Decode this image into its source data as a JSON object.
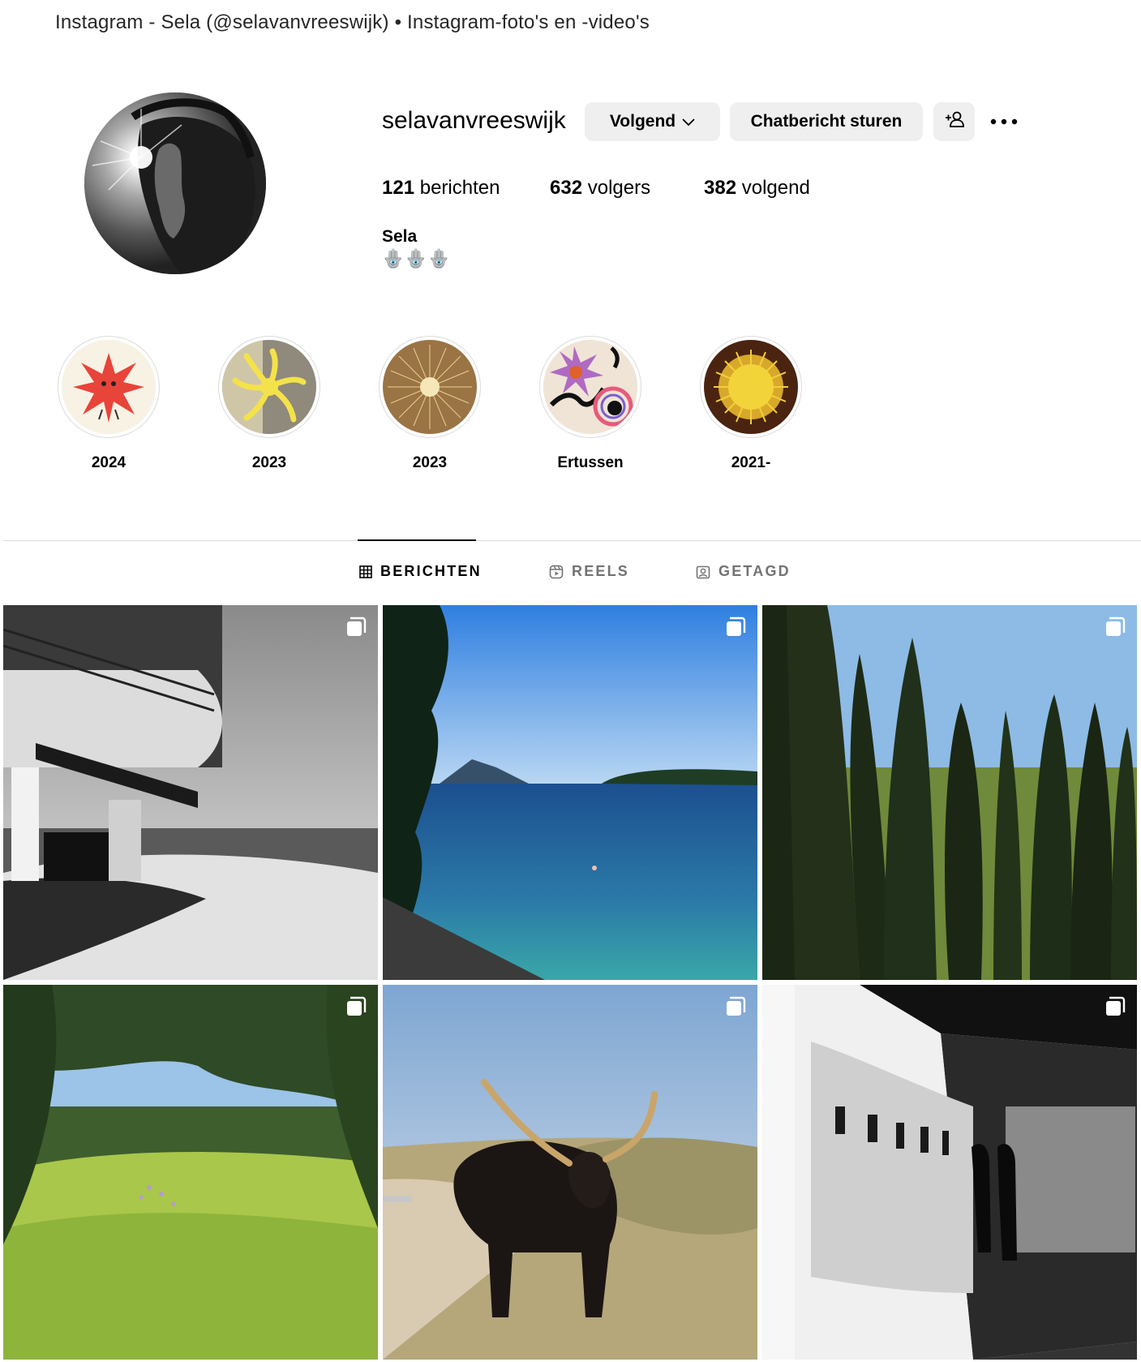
{
  "window": {
    "title": "Instagram - Sela (@selavanvreeswijk) • Instagram-foto's en -video's"
  },
  "profile": {
    "username": "selavanvreeswijk",
    "name": "Sela",
    "bio": "🪬🪬🪬",
    "avatar_icon": "profile-photo"
  },
  "actions": {
    "follow_label": "Volgend",
    "message_label": "Chatbericht sturen",
    "suggest_icon": "add-person-icon",
    "more_icon": "more-options-icon"
  },
  "stats": {
    "posts_count": "121",
    "posts_label": "berichten",
    "followers_count": "632",
    "followers_label": "volgers",
    "following_count": "382",
    "following_label": "volgend"
  },
  "highlights": [
    {
      "label": "2024"
    },
    {
      "label": "2023"
    },
    {
      "label": "2023"
    },
    {
      "label": "Ertussen"
    },
    {
      "label": "2021-"
    }
  ],
  "tabs": [
    {
      "label": "BERICHTEN",
      "icon": "grid-icon",
      "active": true
    },
    {
      "label": "REELS",
      "icon": "reels-icon",
      "active": false
    },
    {
      "label": "GETAGD",
      "icon": "tagged-icon",
      "active": false
    }
  ],
  "posts": [
    {
      "subject": "beach-pavilion-bw",
      "multi": true
    },
    {
      "subject": "sea-bay",
      "multi": true
    },
    {
      "subject": "cypress-trees",
      "multi": true
    },
    {
      "subject": "forest-meadow",
      "multi": true
    },
    {
      "subject": "highland-cow",
      "multi": true
    },
    {
      "subject": "exhibition-hallway-bw",
      "multi": true
    }
  ],
  "colors": {
    "button_bg": "#efefef",
    "divider": "#dbdbdb",
    "inactive_tab": "#737373"
  }
}
